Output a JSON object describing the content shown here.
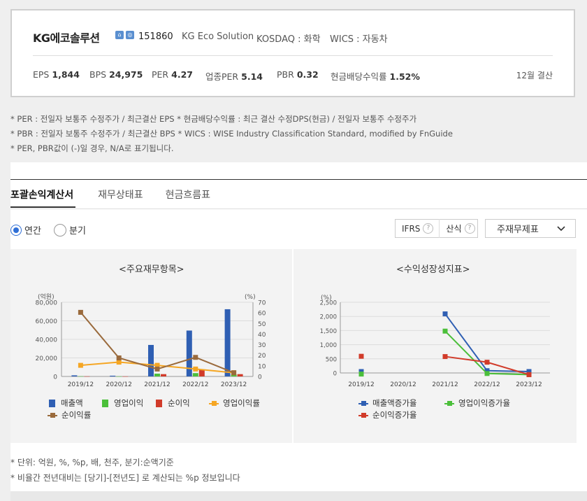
{
  "company": {
    "name": "KG에코솔루션",
    "code": "151860",
    "eng_name": "KG Eco Solution",
    "market": "KOSDAQ : 화학",
    "wics": "WICS : 자동차",
    "settlement": "12월 결산"
  },
  "stats": [
    {
      "label": "EPS",
      "value": "1,844"
    },
    {
      "label": "BPS",
      "value": "24,975"
    },
    {
      "label": "PER",
      "value": "4.27"
    },
    {
      "label": "업종PER",
      "value": "5.14"
    },
    {
      "label": "PBR",
      "value": "0.32"
    },
    {
      "label": "현금배당수익률",
      "value": "1.52%"
    }
  ],
  "notes": [
    "* PER : 전일자 보통주 수정주가 / 최근결산 EPS * 현금배당수익률 : 최근 결산 수정DPS(현금) / 전일자 보통주 수정주가",
    "* PBR : 전일자 보통주 수정주가 / 최근결산 BPS * WICS : WISE Industry Classification Standard, modified by FnGuide",
    "* PER, PBR값이 (-)일 경우, N/A로 표기됩니다."
  ],
  "tabs": [
    "포괄손익계산서",
    "재무상태표",
    "현금흐름표"
  ],
  "radios": [
    "연간",
    "분기"
  ],
  "options": {
    "ifrs": "IFRS",
    "sansik": "산식",
    "q": "?",
    "select": "주재무제표"
  },
  "panels": {
    "left_title": "<주요재무항목>",
    "right_title": "<수익성장성지표>"
  },
  "footnotes": [
    "* 단위: 억원, %, %p, 배, 천주, 분기:순액기준",
    "* 비율간 전년대비는 [당기]-[전년도] 로 계산되는 %p 정보입니다"
  ],
  "colors": {
    "blue": "#2f5fb3",
    "green": "#4bbf3a",
    "red": "#d13b2a",
    "orange": "#f5a623",
    "brown": "#9a6a3c",
    "accent": "#2f6fd6"
  },
  "chart_data": [
    {
      "type": "bar",
      "title": "<주요재무항목>",
      "categories": [
        "2019/12",
        "2020/12",
        "2021/12",
        "2022/12",
        "2023/12"
      ],
      "ylabel": "(억원)",
      "ylabel_right": "(%)",
      "ylim": [
        0,
        80000
      ],
      "ylim_right": [
        0,
        70
      ],
      "yticks": [
        "0",
        "20,000",
        "40,000",
        "60,000",
        "80,000"
      ],
      "yticks_right": [
        "0",
        "10",
        "20",
        "30",
        "40",
        "50",
        "60",
        "70"
      ],
      "bar_series": [
        {
          "name": "매출액",
          "color": "#2f5fb3",
          "values": [
            1200,
            800,
            34000,
            49500,
            72500
          ]
        },
        {
          "name": "영업이익",
          "color": "#4bbf3a",
          "values": [
            200,
            100,
            3000,
            3600,
            2200
          ]
        },
        {
          "name": "순이익",
          "color": "#d13b2a",
          "values": [
            150,
            100,
            2500,
            7500,
            2500
          ]
        }
      ],
      "line_series": [
        {
          "name": "영업이익률",
          "color": "#f5a623",
          "axis": "right",
          "values": [
            10.5,
            13.5,
            10.5,
            7.0,
            3.5
          ]
        },
        {
          "name": "순이익률",
          "color": "#9a6a3c",
          "axis": "right",
          "values": [
            60.5,
            17.5,
            7.0,
            18.0,
            3.5
          ]
        }
      ],
      "legend": [
        "매출액",
        "영업이익",
        "순이익",
        "영업이익률",
        "순이익률"
      ],
      "grid": true
    },
    {
      "type": "line",
      "title": "<수익성장성지표>",
      "categories": [
        "2019/12",
        "2020/12",
        "2021/12",
        "2022/12",
        "2023/12"
      ],
      "ylabel": "(%)",
      "ylim": [
        0,
        2500
      ],
      "yticks": [
        "0",
        "500",
        "1,000",
        "1,500",
        "2,000",
        "2,500"
      ],
      "series": [
        {
          "name": "매출액증가율",
          "color": "#2f5fb3",
          "values": [
            50,
            null,
            2090,
            80,
            50
          ]
        },
        {
          "name": "영업이익증가율",
          "color": "#4bbf3a",
          "values": [
            -40,
            null,
            1480,
            -20,
            -60
          ]
        },
        {
          "name": "순이익증가율",
          "color": "#d13b2a",
          "values": [
            590,
            null,
            580,
            380,
            -60
          ]
        }
      ],
      "legend": [
        "매출액증가율",
        "영업이익증가율",
        "순이익증가율"
      ],
      "grid": true
    }
  ]
}
